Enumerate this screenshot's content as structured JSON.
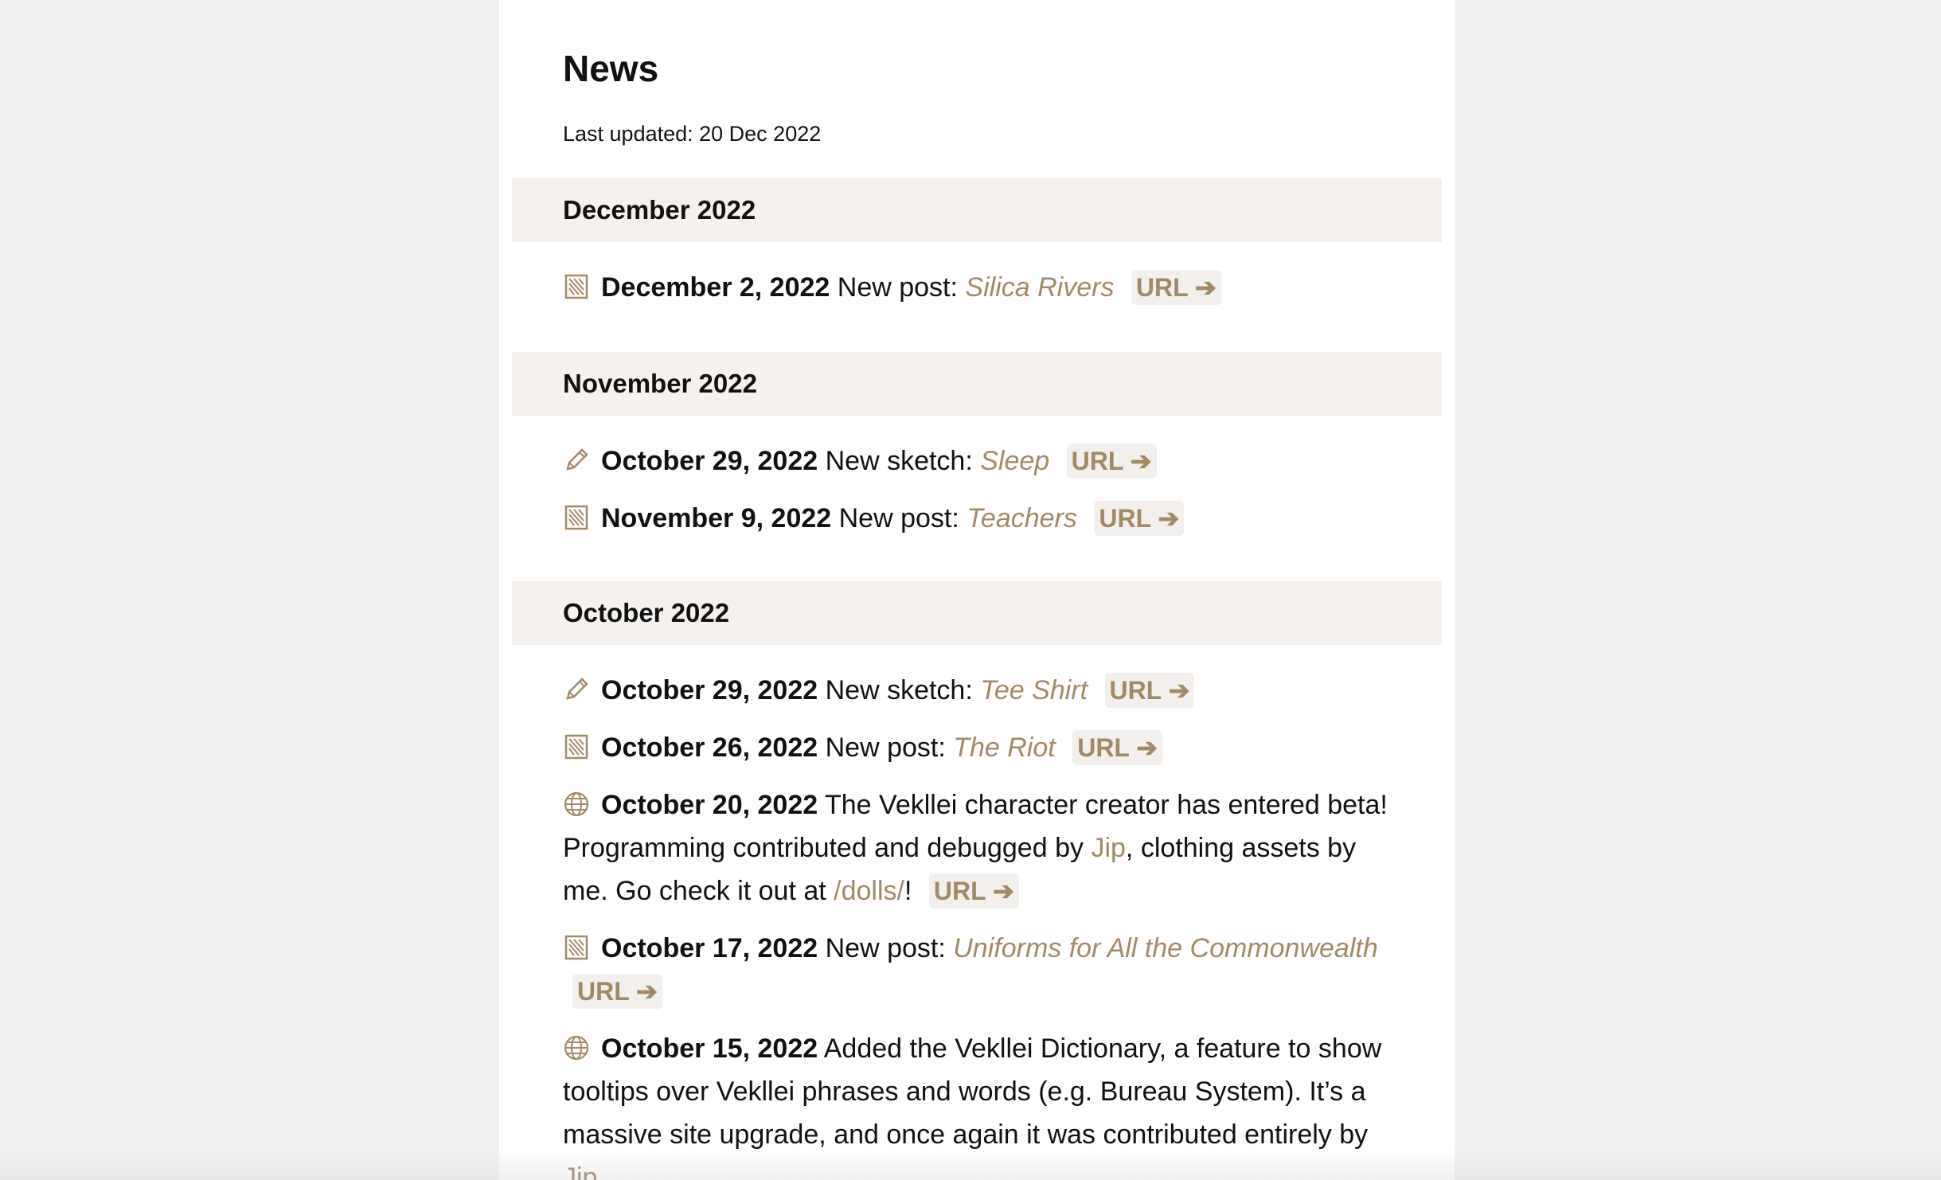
{
  "page": {
    "title": "News",
    "last_updated": "Last updated: 20 Dec 2022"
  },
  "colors": {
    "accent": "#a38a66",
    "month_bg": "#f4f1ee",
    "page_bg": "#f3f1ef"
  },
  "months": [
    {
      "label": "December 2022",
      "entries": [
        {
          "icon": "notebook-icon",
          "date": "December 2, 2022",
          "text": "New post:",
          "title": "Silica Rivers",
          "url_label": "URL ➔"
        }
      ]
    },
    {
      "label": "November 2022",
      "entries": [
        {
          "icon": "pencil-icon",
          "date": "October 29, 2022",
          "text": "New sketch:",
          "title": "Sleep",
          "url_label": "URL ➔"
        },
        {
          "icon": "notebook-icon",
          "date": "November 9, 2022",
          "text": "New post:",
          "title": "Teachers",
          "url_label": "URL ➔"
        }
      ]
    },
    {
      "label": "October 2022",
      "entries": [
        {
          "icon": "pencil-icon",
          "date": "October 29, 2022",
          "text": "New sketch:",
          "title": "Tee Shirt",
          "url_label": "URL ➔"
        },
        {
          "icon": "notebook-icon",
          "date": "October 26, 2022",
          "text": "New post:",
          "title": "The Riot",
          "url_label": "URL ➔"
        },
        {
          "icon": "globe-icon",
          "date": "October 20, 2022",
          "text_1": "The Vekllei character creator has entered beta! Programming contributed and debugged by",
          "link_1": "Jip",
          "text_2": ", clothing assets by me. Go check it out at",
          "link_2": "/dolls/",
          "text_3": "!",
          "url_label": "URL ➔"
        },
        {
          "icon": "notebook-icon",
          "date": "October 17, 2022",
          "text": "New post:",
          "title": "Uniforms for All the Commonwealth",
          "url_label": "URL ➔"
        },
        {
          "icon": "globe-icon",
          "date": "October 15, 2022",
          "text_1": "Added the Vekllei Dictionary, a feature to show tooltips over Vekllei phrases and words (e.g. Bureau System). It’s a massive site upgrade, and once again it was contributed entirely by",
          "link_1": "Jip"
        }
      ]
    }
  ]
}
